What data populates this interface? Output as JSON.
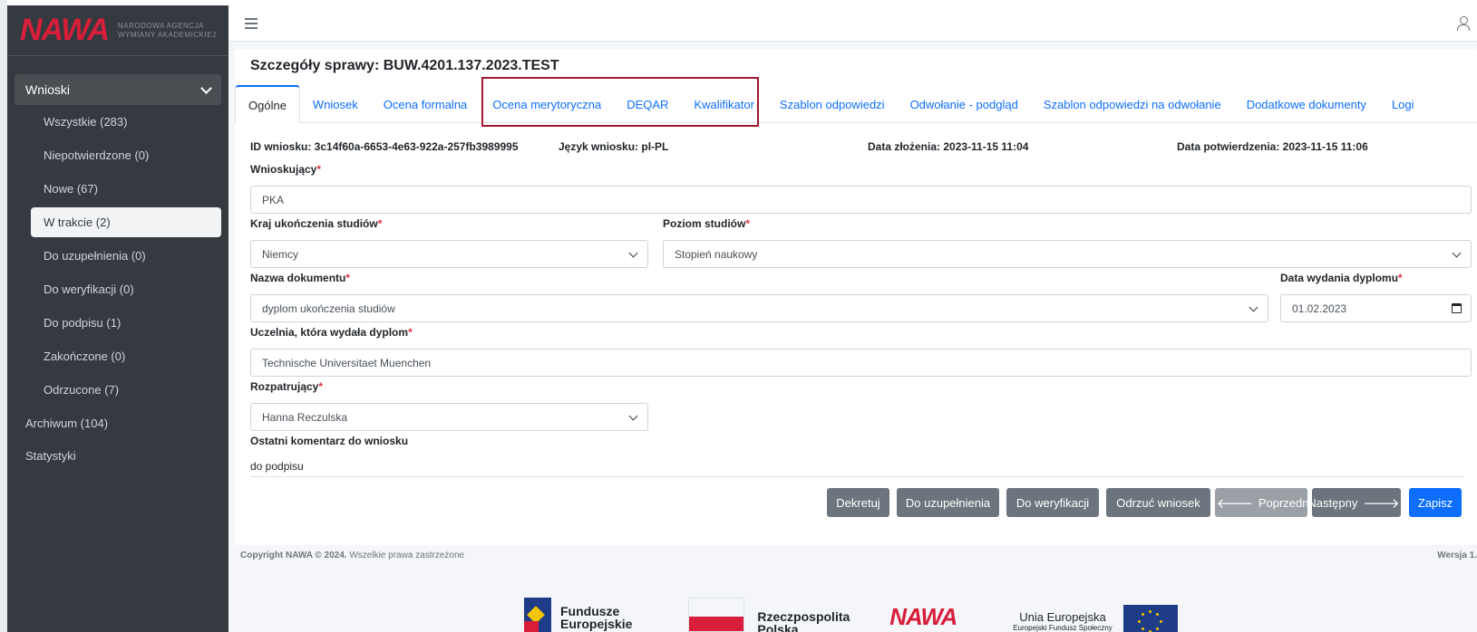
{
  "brand": {
    "logo": "NAWA",
    "logo_subtitle_line1": "NARODOWA AGENCJA",
    "logo_subtitle_line2": "WYMIANY AKADEMICKIEJ"
  },
  "sidebar": {
    "group_label": "Wnioski",
    "items": [
      {
        "label": "Wszystkie (283)"
      },
      {
        "label": "Niepotwierdzone (0)"
      },
      {
        "label": "Nowe (67)"
      },
      {
        "label": "W trakcie (2)"
      },
      {
        "label": "Do uzupełnienia (0)"
      },
      {
        "label": "Do weryfikacji (0)"
      },
      {
        "label": "Do podpisu (1)"
      },
      {
        "label": "Zakończone (0)"
      },
      {
        "label": "Odrzucone (7)"
      }
    ],
    "active_item": "W trakcie (2)",
    "archive_label": "Archiwum (104)",
    "stats_label": "Statystyki"
  },
  "page": {
    "title": "Szczegóły sprawy: BUW.4201.137.2023.TEST"
  },
  "tabs": [
    {
      "label": "Ogólne"
    },
    {
      "label": "Wniosek"
    },
    {
      "label": "Ocena formalna"
    },
    {
      "label": "Ocena merytoryczna"
    },
    {
      "label": "DEQAR"
    },
    {
      "label": "Kwalifikator"
    },
    {
      "label": "Szablon odpowiedzi"
    },
    {
      "label": "Odwołanie - podgląd"
    },
    {
      "label": "Szablon odpowiedzi na odwołanie"
    },
    {
      "label": "Dodatkowe dokumenty"
    },
    {
      "label": "Logi"
    }
  ],
  "meta": {
    "id": "ID wniosku: 3c14f60a-6653-4e63-922a-257fb3989995",
    "language": "Język wniosku: pl-PL",
    "submitted": "Data złożenia: 2023-11-15 11:04",
    "confirmed": "Data potwierdzenia: 2023-11-15 11:06"
  },
  "form": {
    "applicant_label": "Wnioskujący",
    "applicant_value": "PKA",
    "country_label": "Kraj ukończenia studiów",
    "country_value": "Niemcy",
    "level_label": "Poziom studiów",
    "level_value": "Stopień naukowy",
    "doc_name_label": "Nazwa dokumentu",
    "doc_name_value": "dyplom ukończenia studiów",
    "issue_date_label": "Data wydania dyplomu",
    "issue_date_value": "01.02.2023",
    "university_label": "Uczelnia, która wydała dyplom",
    "university_value": "Technische Universitaet Muenchen",
    "reviewer_label": "Rozpatrujący",
    "reviewer_value": "Hanna Reczulska",
    "comment_label": "Ostatni komentarz do wniosku",
    "comment_value": "do podpisu",
    "required_mark": "*"
  },
  "actions": {
    "assign": "Dekretuj",
    "to_complete": "Do uzupełnienia",
    "to_verify": "Do weryfikacji",
    "reject": "Odrzuć wniosek",
    "previous": "Poprzedni",
    "next": "Następny",
    "save": "Zapisz",
    "arrow_left": "🡐",
    "arrow_right": "🡒"
  },
  "footer": {
    "copyright_bold": "Copyright NAWA © 2024.",
    "copyright_rest": " Wszelkie prawa zastrzeżone",
    "version": "Wersja 1."
  },
  "partner_logos": {
    "fe_line1": "Fundusze",
    "fe_line2": "Europejskie",
    "rp_line1": "Rzeczpospolita",
    "rp_line2": "Polska",
    "nawa": "NAWA",
    "ue_title": "Unia Europejska",
    "ue_sub": "Europejski Fundusz Społeczny"
  },
  "colors": {
    "sidebar_bg": "#343a40",
    "link_blue": "#0d6efd",
    "brand_red": "#d81e3a",
    "highlight_border": "#a0192f",
    "button_gray": "#6c757d"
  }
}
